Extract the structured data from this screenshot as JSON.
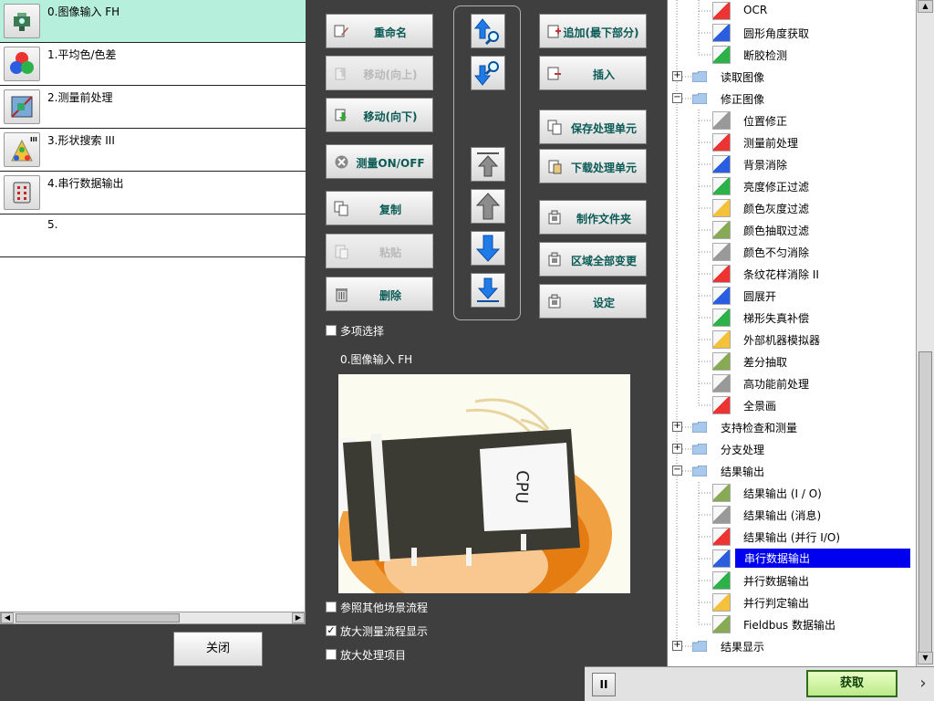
{
  "flow": {
    "items": [
      {
        "label": "0.图像输入 FH",
        "icon": "camera-input-icon"
      },
      {
        "label": "1.平均色/色差",
        "icon": "color-circles-icon"
      },
      {
        "label": "2.测量前处理",
        "icon": "preprocess-icon"
      },
      {
        "label": "3.形状搜索 III",
        "icon": "shape-search-icon",
        "badge": "III"
      },
      {
        "label": "4.串行数据输出",
        "icon": "serial-output-icon"
      },
      {
        "label": "5.",
        "icon": ""
      }
    ],
    "selected_index": 0,
    "close_label": "关闭"
  },
  "buttons": {
    "rename": "重命名",
    "move_up": "移动(向上)",
    "move_down": "移动(向下)",
    "measure_onoff": "测量ON/OFF",
    "copy": "复制",
    "paste": "粘贴",
    "delete": "删除",
    "append": "追加(最下部分)",
    "insert": "插入",
    "save_unit": "保存处理单元",
    "load_unit": "下载处理单元",
    "make_folder": "制作文件夹",
    "change_all_regions": "区域全部变更",
    "settings": "设定"
  },
  "checkboxes": {
    "multi_select": {
      "label": "多项选择",
      "checked": false
    },
    "ref_other_scene": {
      "label": "参照其他场景流程",
      "checked": false
    },
    "enlarge_flow": {
      "label": "放大测量流程显示",
      "checked": true
    },
    "enlarge_items": {
      "label": "放大处理项目",
      "checked": false
    }
  },
  "preview": {
    "title": "0.图像输入 FH",
    "chip_text": "CPU"
  },
  "tree": {
    "items": [
      {
        "label": "OCR",
        "type": "item"
      },
      {
        "label": "圆形角度获取",
        "type": "item"
      },
      {
        "label": "断胶检测",
        "type": "item"
      },
      {
        "label": "读取图像",
        "type": "folder",
        "expanded": false
      },
      {
        "label": "修正图像",
        "type": "folder",
        "expanded": true
      },
      {
        "label": "位置修正",
        "type": "item"
      },
      {
        "label": "测量前处理",
        "type": "item"
      },
      {
        "label": "背景消除",
        "type": "item"
      },
      {
        "label": "亮度修正过滤",
        "type": "item"
      },
      {
        "label": "颜色灰度过滤",
        "type": "item"
      },
      {
        "label": "颜色抽取过滤",
        "type": "item"
      },
      {
        "label": "颜色不匀消除",
        "type": "item"
      },
      {
        "label": "条纹花样消除 II",
        "type": "item"
      },
      {
        "label": "圆展开",
        "type": "item"
      },
      {
        "label": "梯形失真补偿",
        "type": "item"
      },
      {
        "label": "外部机器模拟器",
        "type": "item"
      },
      {
        "label": "差分抽取",
        "type": "item"
      },
      {
        "label": "高功能前处理",
        "type": "item"
      },
      {
        "label": "全景画",
        "type": "item"
      },
      {
        "label": "支持检查和测量",
        "type": "folder",
        "expanded": false
      },
      {
        "label": "分支处理",
        "type": "folder",
        "expanded": false
      },
      {
        "label": "结果输出",
        "type": "folder",
        "expanded": true
      },
      {
        "label": "结果输出 (I / O)",
        "type": "item"
      },
      {
        "label": "结果输出 (消息)",
        "type": "item"
      },
      {
        "label": "结果输出 (并行 I/O)",
        "type": "item"
      },
      {
        "label": "串行数据输出",
        "type": "item",
        "selected": true
      },
      {
        "label": "并行数据输出",
        "type": "item"
      },
      {
        "label": "并行判定输出",
        "type": "item"
      },
      {
        "label": "Fieldbus 数据输出",
        "type": "item"
      },
      {
        "label": "结果显示",
        "type": "folder",
        "expanded": false
      }
    ]
  },
  "bottom": {
    "pause_label": "II",
    "acquire_label": "获取"
  },
  "colors": {
    "selected_row": "#b6f0dc",
    "tree_highlight": "#0000ee",
    "button_text": "#0a5a55",
    "acquire_bg": "#bde98a"
  }
}
